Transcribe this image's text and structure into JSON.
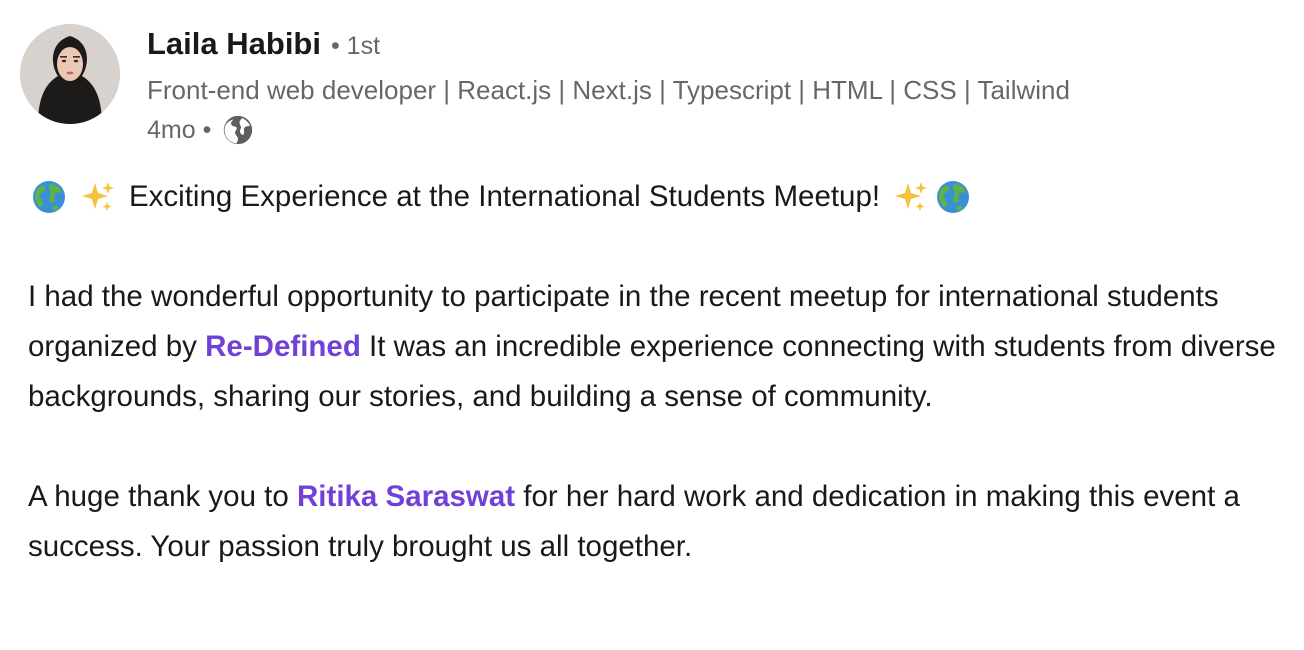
{
  "author": {
    "name": "Laila Habibi",
    "degree": "• 1st",
    "headline": "Front-end web developer | React.js | Next.js | Typescript | HTML | CSS | Tailwind",
    "timestamp": "4mo •",
    "visibility_icon": "globe-icon"
  },
  "post": {
    "title": {
      "emoji_left": [
        "globe-emoji",
        "sparkles-emoji"
      ],
      "text": "Exciting Experience at the International Students Meetup!",
      "emoji_right": [
        "sparkles-emoji",
        "globe-emoji"
      ]
    },
    "paragraph1": {
      "before": "I had the wonderful opportunity to participate in the recent meetup for international students organized by ",
      "mention": "Re-Defined",
      "after": " It was an incredible experience connecting with students from diverse backgrounds, sharing our stories, and building a sense of community."
    },
    "paragraph2": {
      "before": "A huge thank you to ",
      "mention": "Ritika Saraswat",
      "after": " for her hard work and dedication in making this event a success. Your passion truly brought us all together."
    }
  },
  "colors": {
    "mention": "#7140d6",
    "text": "#1a1a1a",
    "secondary_text": "#666666"
  }
}
